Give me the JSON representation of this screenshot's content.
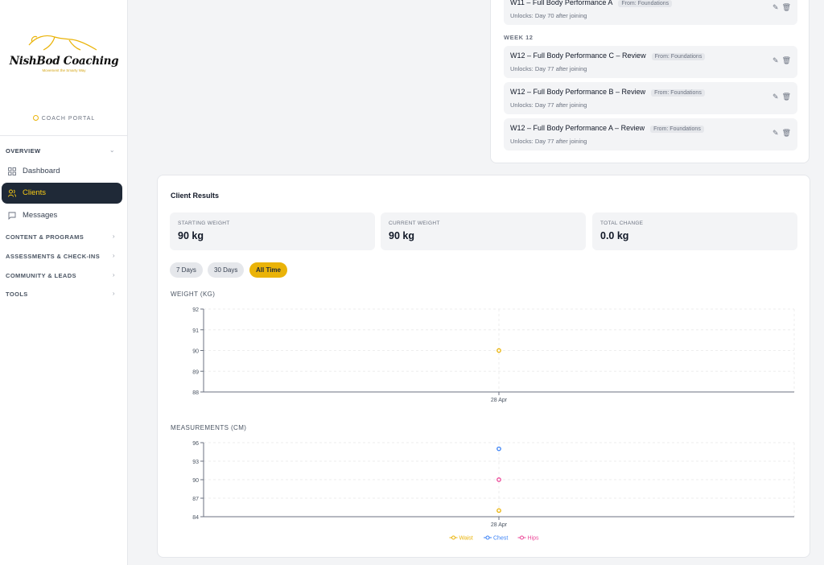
{
  "brand": {
    "name": "NishBod Coaching",
    "tagline": "Movement the Smarty Way",
    "portal_label": "COACH PORTAL"
  },
  "sidebar": {
    "overview_label": "OVERVIEW",
    "items": [
      {
        "label": "Dashboard",
        "icon": "grid-icon"
      },
      {
        "label": "Clients",
        "icon": "users-icon",
        "active": true
      },
      {
        "label": "Messages",
        "icon": "message-icon"
      }
    ],
    "sections": [
      {
        "label": "CONTENT & PROGRAMS"
      },
      {
        "label": "ASSESSMENTS & CHECK-INS"
      },
      {
        "label": "COMMUNITY & LEADS"
      },
      {
        "label": "TOOLS"
      }
    ]
  },
  "program": {
    "items_top": [
      {
        "title": "W11 – Full Body Performance A",
        "tag": "From: Foundations",
        "unlock": "Unlocks: Day 70 after joining"
      }
    ],
    "week12_label": "WEEK 12",
    "items_week12": [
      {
        "title": "W12 – Full Body Performance C – Review",
        "tag": "From: Foundations",
        "unlock": "Unlocks: Day 77 after joining"
      },
      {
        "title": "W12 – Full Body Performance B – Review",
        "tag": "From: Foundations",
        "unlock": "Unlocks: Day 77 after joining"
      },
      {
        "title": "W12 – Full Body Performance A – Review",
        "tag": "From: Foundations",
        "unlock": "Unlocks: Day 77 after joining"
      }
    ]
  },
  "results": {
    "title": "Client Results",
    "stats": [
      {
        "label": "STARTING WEIGHT",
        "value": "90 kg"
      },
      {
        "label": "CURRENT WEIGHT",
        "value": "90 kg"
      },
      {
        "label": "TOTAL CHANGE",
        "value": "0.0 kg"
      }
    ],
    "ranges": [
      {
        "label": "7 Days"
      },
      {
        "label": "30 Days"
      },
      {
        "label": "All Time",
        "active": true
      }
    ],
    "weight_chart_label": "WEIGHT (KG)",
    "measurements_chart_label": "MEASUREMENTS (CM)"
  },
  "colors": {
    "accent": "#eab308",
    "chest": "#3b82f6",
    "hips": "#ec4899",
    "sidebar_active_bg": "#1f2937"
  },
  "chart_data": [
    {
      "type": "line",
      "title": "WEIGHT (KG)",
      "x": [
        "28 Apr"
      ],
      "series": [
        {
          "values": [
            90
          ],
          "color": "#eab308"
        }
      ],
      "ylim": [
        88,
        92
      ],
      "yticks": [
        88,
        89,
        90,
        91,
        92
      ],
      "grid": true
    },
    {
      "type": "line",
      "title": "MEASUREMENTS (CM)",
      "x": [
        "28 Apr"
      ],
      "series": [
        {
          "name": "Waist",
          "values": [
            85
          ],
          "color": "#eab308"
        },
        {
          "name": "Chest",
          "values": [
            95
          ],
          "color": "#3b82f6"
        },
        {
          "name": "Hips",
          "values": [
            90
          ],
          "color": "#ec4899"
        }
      ],
      "ylim": [
        84,
        96
      ],
      "yticks": [
        84,
        87,
        90,
        93,
        96
      ],
      "legend": "bottom",
      "grid": true
    }
  ]
}
